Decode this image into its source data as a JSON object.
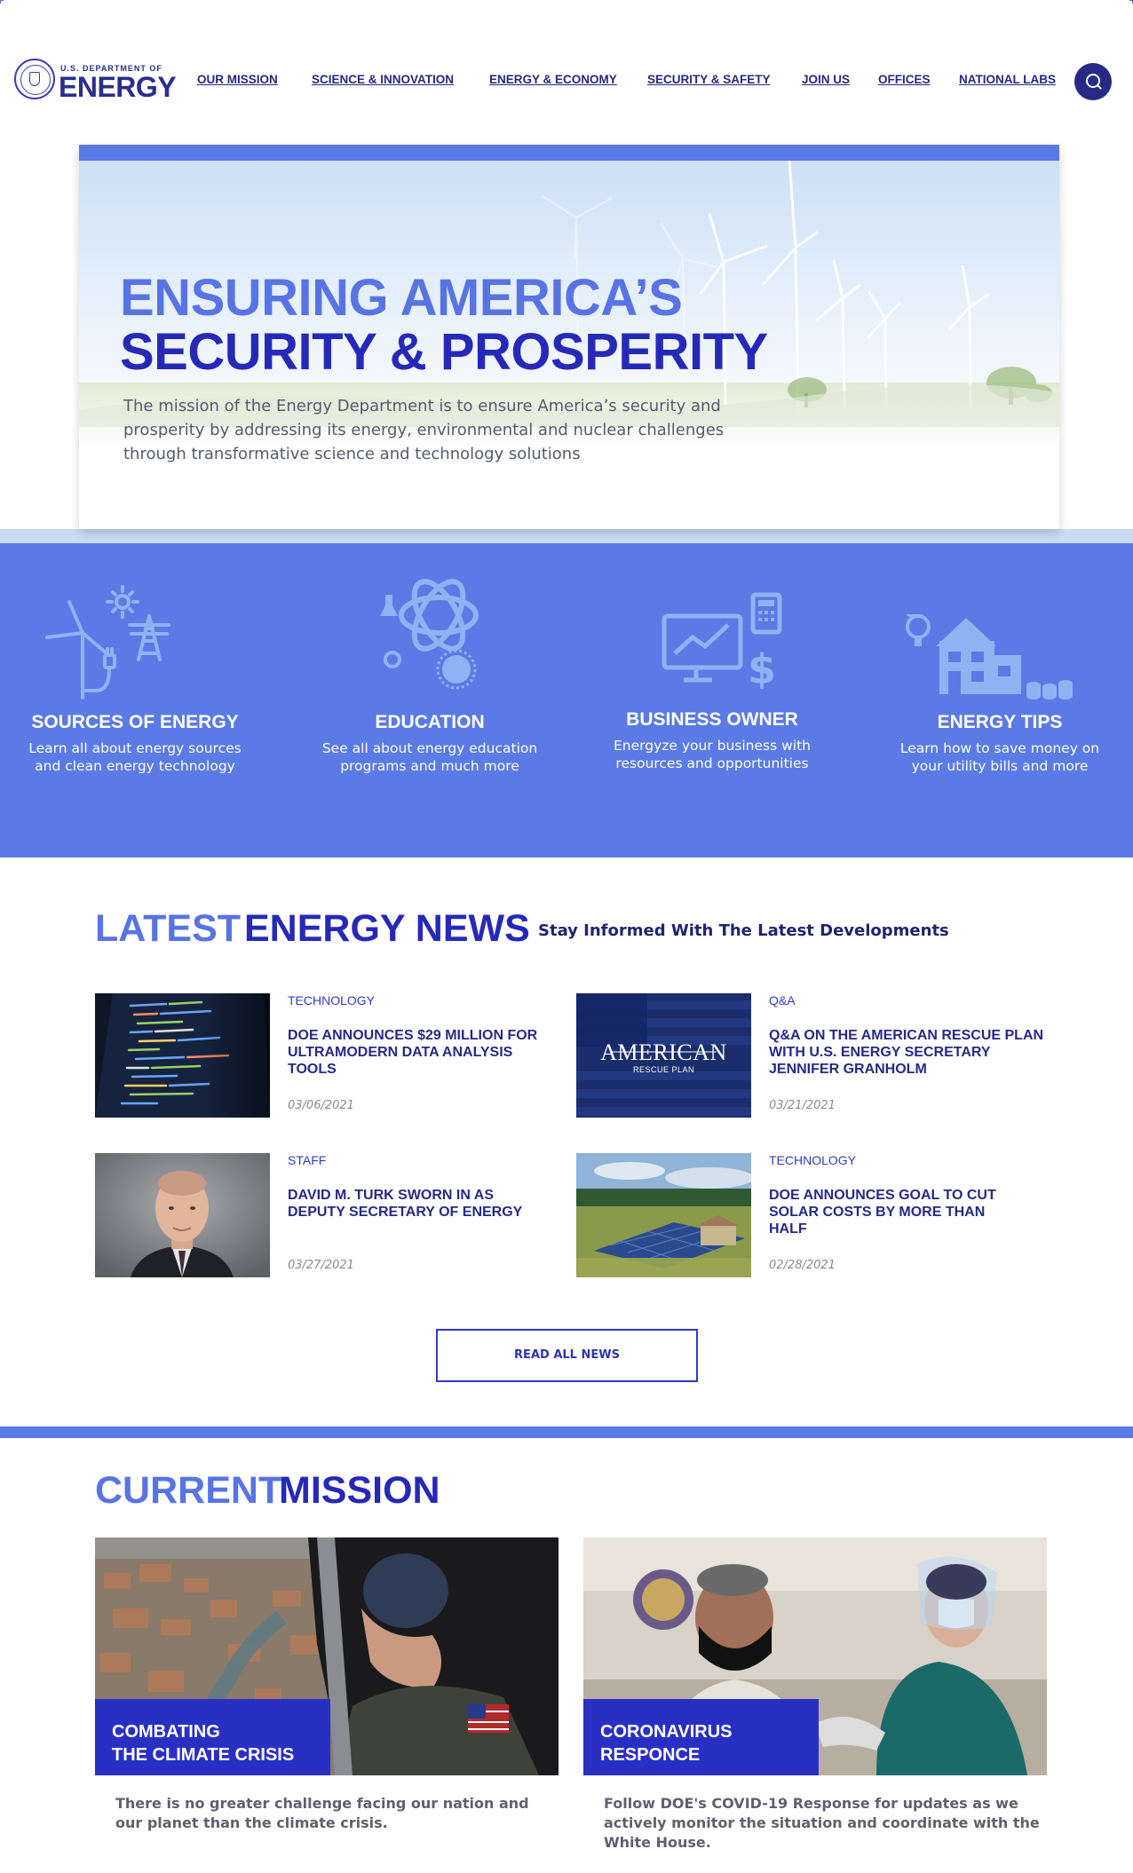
{
  "header": {
    "logo_top": "U.S. DEPARTMENT OF",
    "logo_main": "ENERGY",
    "nav": [
      "OUR MISSION",
      "SCIENCE & INNOVATION",
      "ENERGY & ECONOMY",
      "SECURITY & SAFETY",
      "JOIN US",
      "OFFICES",
      "NATIONAL LABS"
    ],
    "search_icon": "search-icon"
  },
  "hero": {
    "title_line1": "ENSURING AMERICA’S",
    "title_line2": "SECURITY & PROSPERITY",
    "description": "The mission of the Energy Department is to ensure America’s security and prosperity by addressing its energy, environmental and nuclear challenges through transformative science and technology solutions"
  },
  "features": [
    {
      "icon": "wind-power-icon",
      "title": "SOURCES OF ENERGY",
      "desc_line1": "Learn all about energy sources",
      "desc_line2": "and clean energy technology"
    },
    {
      "icon": "atom-icon",
      "title": "EDUCATION",
      "desc_line1": "See all about energy education",
      "desc_line2": "programs and much more"
    },
    {
      "icon": "business-chart-icon",
      "title": "BUSINESS OWNER",
      "desc_line1": "Energyze your business with",
      "desc_line2": "resources and opportunities"
    },
    {
      "icon": "house-savings-icon",
      "title": "ENERGY TIPS",
      "desc_line1": "Learn how to save money on",
      "desc_line2": "your utility bills and more"
    }
  ],
  "news": {
    "heading_part1": "LATEST",
    "heading_part2": "ENERGY NEWS",
    "subheading": "Stay Informed With The Latest Developments",
    "items": [
      {
        "category": "TECHNOLOGY",
        "title": "DOE Announces $29 Million for Ultramodern Data Analysis Tools",
        "date": "03/06/2021"
      },
      {
        "category": "Q&A",
        "title": "Q&A on the American Rescue Plan with U.S. Energy Secretary Jennifer Granholm",
        "date": "03/21/2021",
        "image_text_1": "AMERICAN",
        "image_text_2": "RESCUE PLAN"
      },
      {
        "category": "STAFF",
        "title": "David M. Turk Sworn In as Deputy Secretary of Energy",
        "date": "03/27/2021"
      },
      {
        "category": "TECHNOLOGY",
        "title": "DOE Announces Goal to Cut Solar Costs by More than Half",
        "date": "02/28/2021"
      }
    ],
    "read_all": "READ ALL NEWS"
  },
  "mission": {
    "heading_part1": "CURRENT",
    "heading_part2": "MISSION",
    "cards": [
      {
        "label_line1": "COMBATING",
        "label_line2": "THE CLIMATE CRISIS",
        "desc": "There is no greater challenge facing our nation and our planet than the climate crisis."
      },
      {
        "label_line1": "CORONAVIRUS",
        "label_line2": "RESPONCE",
        "desc": "Follow DOE's COVID-19 Response for updates as we actively monitor the situation and coordinate with the White House."
      }
    ]
  },
  "colors": {
    "primary_dark": "#2629b8",
    "primary_light": "#5874e4",
    "band": "#5a7ae6",
    "nav_text": "#25297e"
  }
}
